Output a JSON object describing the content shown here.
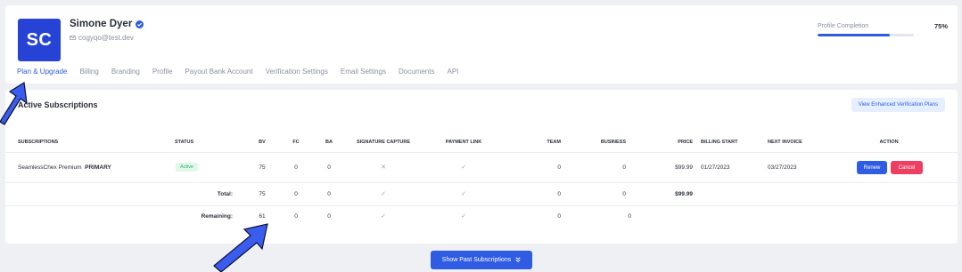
{
  "profile": {
    "avatar_initials": "SC",
    "name": "Simone Dyer",
    "email": "cogyqo@test.dev",
    "completion_label": "Profile Completion",
    "completion_value": "75%",
    "completion_fraction": 0.75,
    "accent_color": "#2f5ce3"
  },
  "tabs": [
    {
      "label": "Plan & Upgrade",
      "active": true
    },
    {
      "label": "Billing"
    },
    {
      "label": "Branding"
    },
    {
      "label": "Profile"
    },
    {
      "label": "Payout Bank Account"
    },
    {
      "label": "Verification Settings"
    },
    {
      "label": "Email Settings"
    },
    {
      "label": "Documents"
    },
    {
      "label": "API"
    }
  ],
  "subscriptions": {
    "title": "Active Subscriptions",
    "enhanced_button": "View Enhanced Verification Plans",
    "headers": {
      "subscriptions": "SUBSCRIPTIONS",
      "status": "STATUS",
      "bv": "BV",
      "fc": "FC",
      "ba": "BA",
      "signature_capture": "SIGNATURE CAPTURE",
      "payment_link": "PAYMENT LINK",
      "team": "TEAM",
      "business": "BUSINESS",
      "price": "PRICE",
      "billing_start": "BILLING START",
      "next_invoice": "NEXT INVOICE",
      "action": "ACTION"
    },
    "row": {
      "name": "SeamlessChex Premium",
      "tag": "PRIMARY",
      "status": "Active",
      "bv": "75",
      "fc": "0",
      "ba": "0",
      "signature_capture": "✕",
      "payment_link": "✓",
      "team": "0",
      "business": "0",
      "price": "$99.99",
      "billing_start": "01/27/2023",
      "next_invoice": "03/27/2023",
      "renew": "Renew",
      "cancel": "Cancel"
    },
    "total": {
      "label": "Total:",
      "bv": "75",
      "fc": "0",
      "ba": "0",
      "signature_capture": "✓",
      "payment_link": "✓",
      "team": "0",
      "business": "0",
      "price": "$99.99"
    },
    "remaining": {
      "label": "Remaining:",
      "bv": "61",
      "fc": "0",
      "ba": "0",
      "signature_capture": "✓",
      "payment_link": "✓",
      "team": "0",
      "business": "0"
    }
  },
  "past_button": "Show Past Subscriptions",
  "colors": {
    "renew": "#2f5ce3",
    "cancel": "#ee3e62",
    "active_badge": "#2bb66b",
    "arrow": "#3a5df0"
  }
}
